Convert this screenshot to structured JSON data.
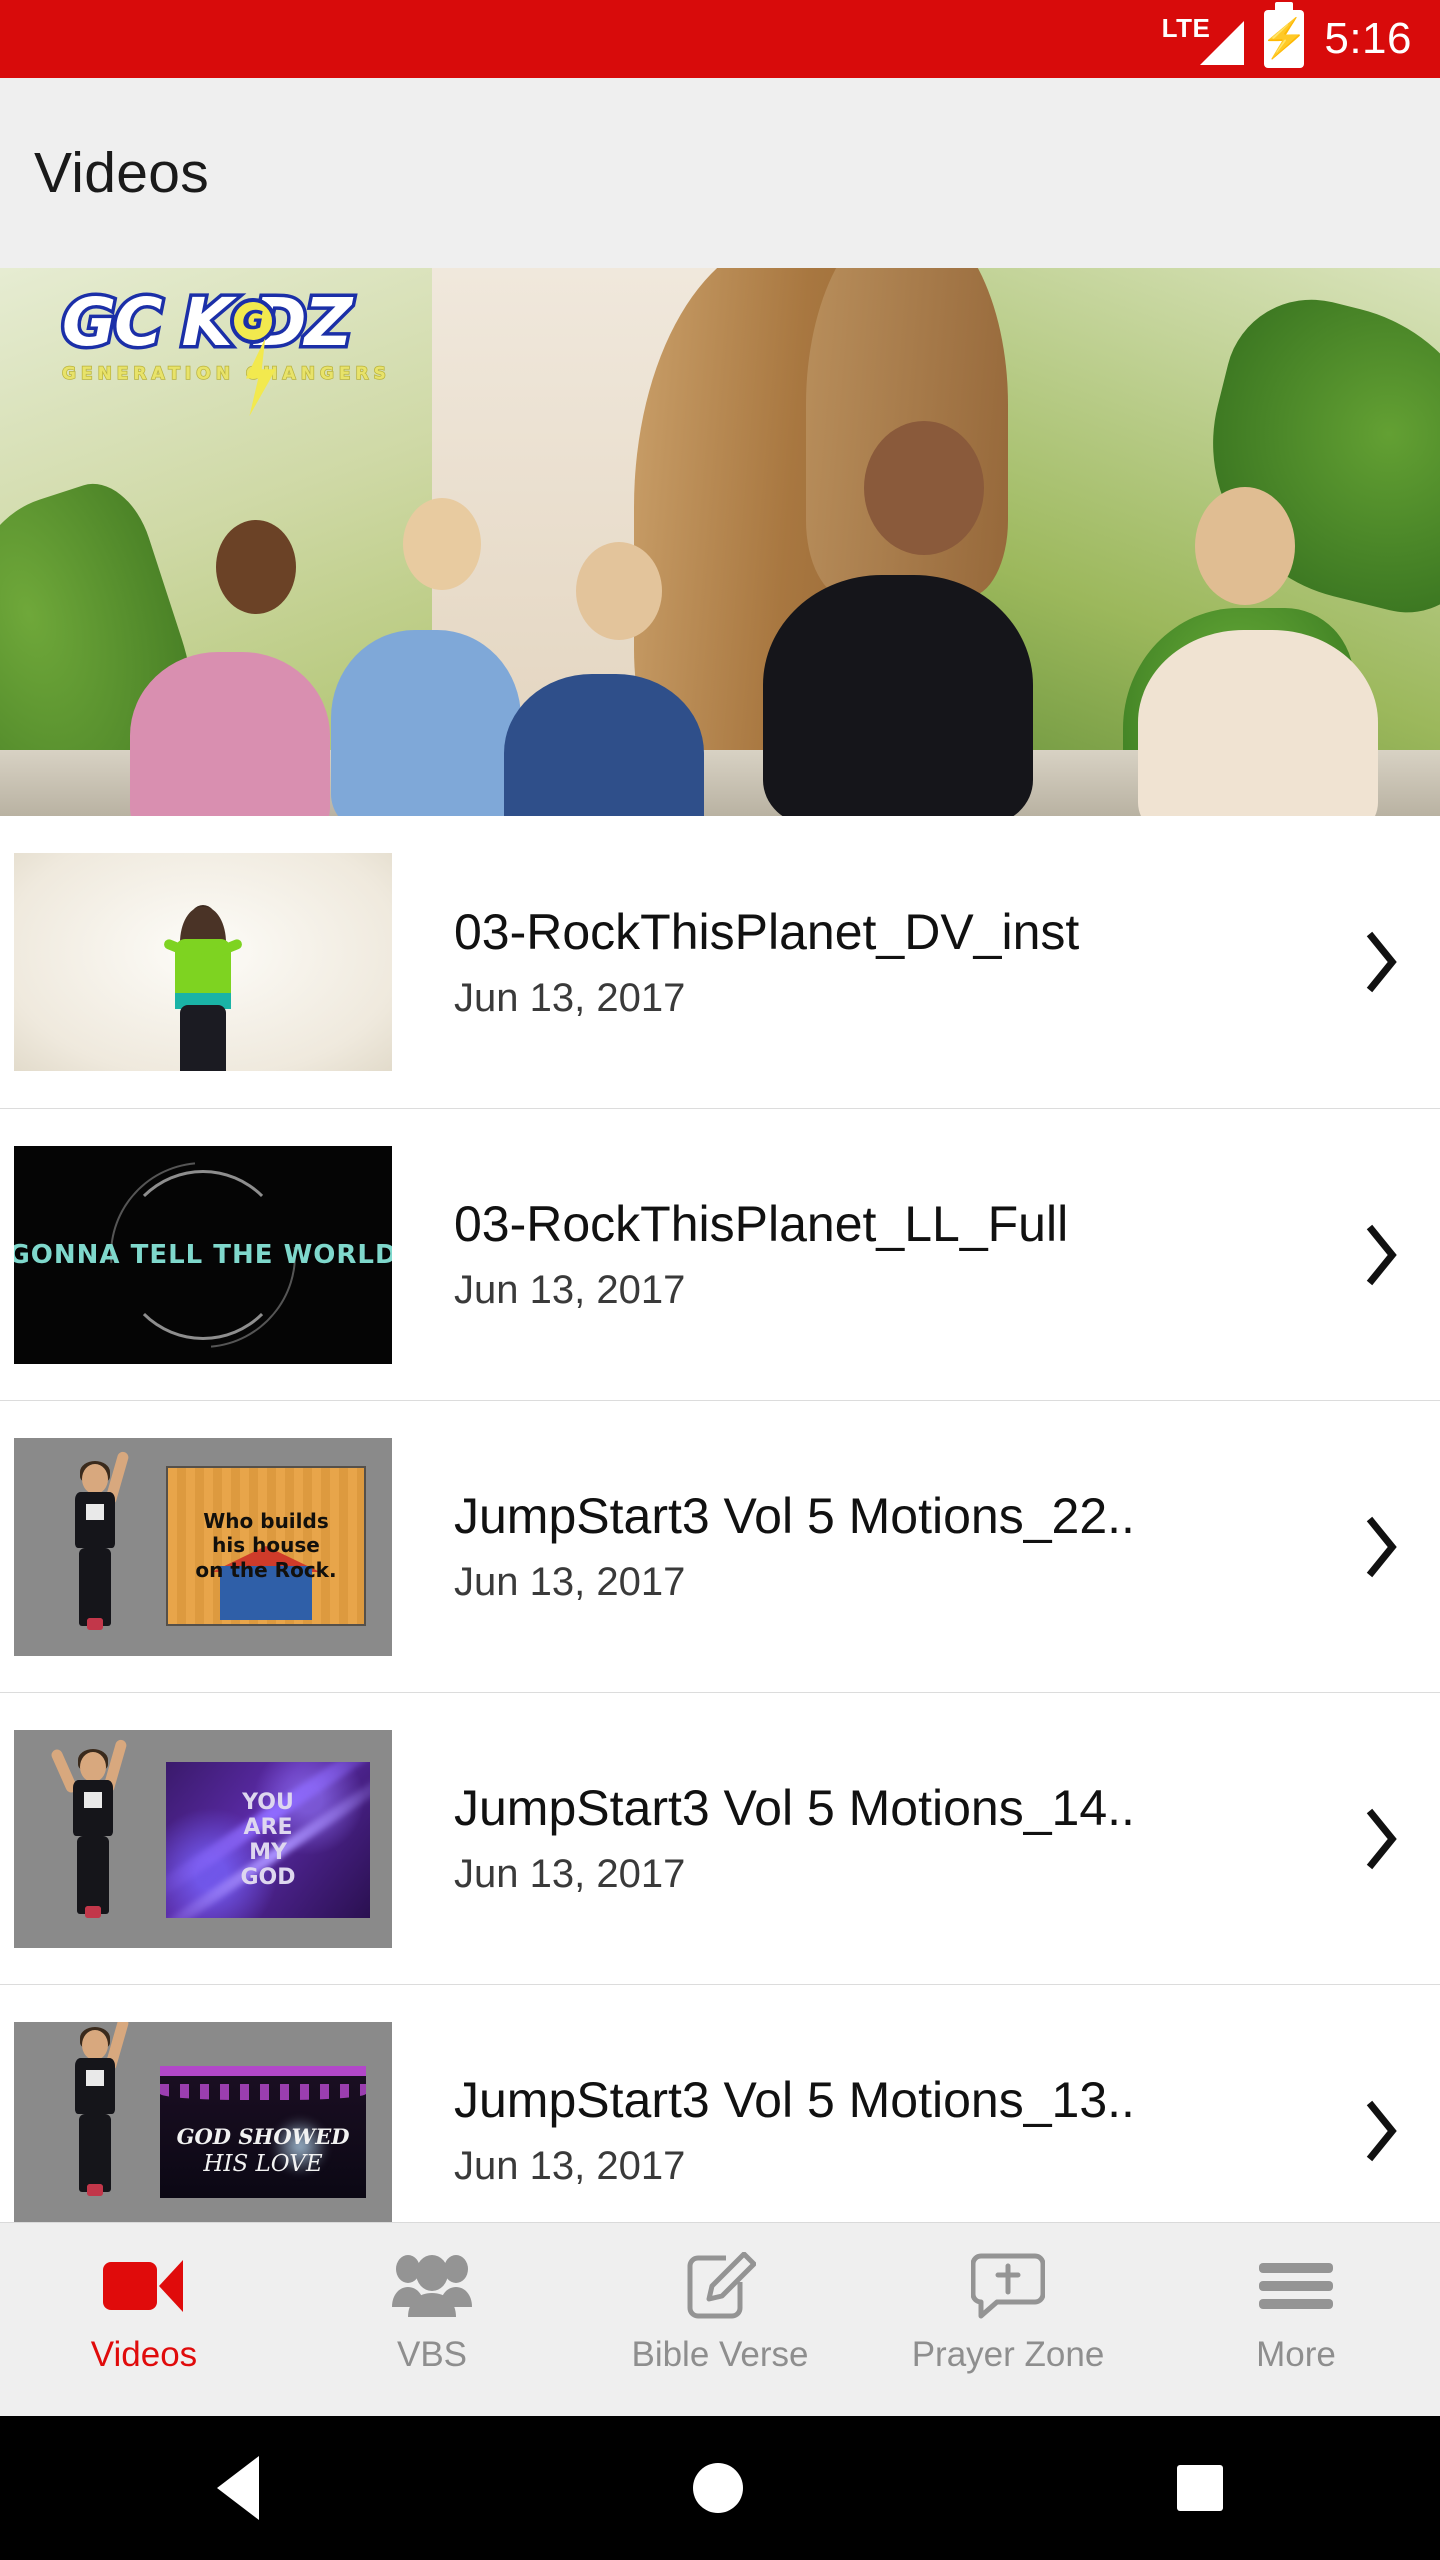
{
  "statusbar": {
    "network": "LTE",
    "signal_icon": "signal-bars-icon",
    "battery_icon": "battery-charging-icon",
    "time": "5:16",
    "bolt_glyph": "⚡"
  },
  "header": {
    "title": "Videos",
    "background": "#efefef"
  },
  "banner": {
    "logo_main": "GC K DZ",
    "logo_badge_letter": "G",
    "logo_sub": "GENERATION CHANGERS",
    "logo_bolt_icon": "lightning-bolt-icon",
    "description": "Children watching in a jungle-themed kids church room"
  },
  "list": {
    "items": [
      {
        "title": "03-RockThisPlanet_DV_inst",
        "date": "Jun 13, 2017",
        "thumb_kind": "white-studio-dancer",
        "chevron_icon": "chevron-right-icon"
      },
      {
        "title": "03-RockThisPlanet_LL_Full",
        "date": "Jun 13, 2017",
        "thumb_kind": "black-lyric-ring",
        "thumb_text": "GONNA TELL THE WORLD",
        "chevron_icon": "chevron-right-icon"
      },
      {
        "title": "JumpStart3 Vol 5 Motions_22..",
        "date": "Jun 13, 2017",
        "thumb_kind": "gray-motions-card",
        "thumb_text_line1": "Who builds",
        "thumb_text_line2": "his house",
        "thumb_text_line3": "on the Rock.",
        "chevron_icon": "chevron-right-icon"
      },
      {
        "title": "JumpStart3 Vol 5 Motions_14..",
        "date": "Jun 13, 2017",
        "thumb_kind": "gray-motions-card",
        "thumb_text_line1": "YOU",
        "thumb_text_line2": "ARE",
        "thumb_text_line3": "MY",
        "thumb_text_line4": "GOD",
        "chevron_icon": "chevron-right-icon"
      },
      {
        "title": "JumpStart3 Vol 5 Motions_13..",
        "date": "Jun 13, 2017",
        "thumb_kind": "gray-motions-card",
        "thumb_text_line1": "GOD SHOWED",
        "thumb_text_line2": "HIS LOVE",
        "chevron_icon": "chevron-right-icon"
      }
    ]
  },
  "tabbar": {
    "active_color": "#e00b0b",
    "inactive_color": "#8e8e8e",
    "tabs": [
      {
        "label": "Videos",
        "icon": "video-camera-icon",
        "active": true
      },
      {
        "label": "VBS",
        "icon": "people-group-icon",
        "active": false
      },
      {
        "label": "Bible Verse",
        "icon": "note-pencil-icon",
        "active": false
      },
      {
        "label": "Prayer Zone",
        "icon": "speech-cross-icon",
        "active": false
      },
      {
        "label": "More",
        "icon": "hamburger-menu-icon",
        "active": false
      }
    ]
  },
  "navbar": {
    "back_icon": "android-back-icon",
    "home_icon": "android-home-icon",
    "recents_icon": "android-recents-icon"
  }
}
